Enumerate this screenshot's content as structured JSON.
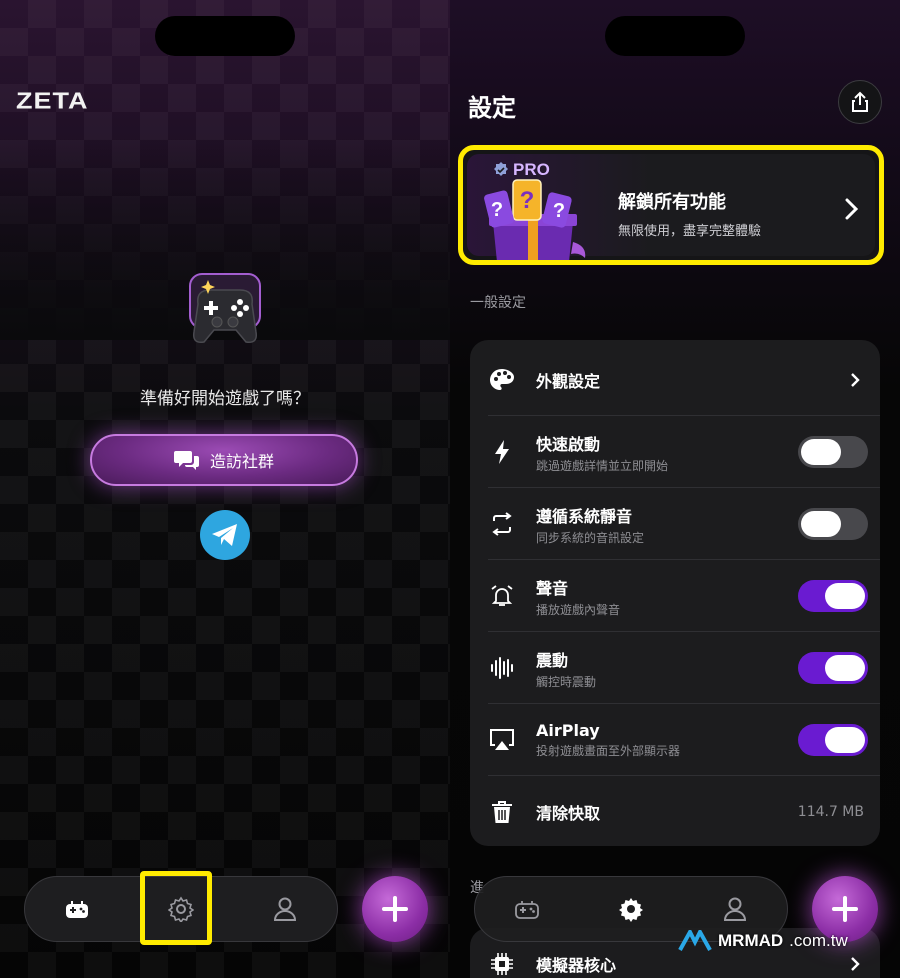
{
  "left": {
    "logo": "ZETA",
    "ready_text": "準備好開始遊戲了嗎？",
    "community_button": "造訪社群",
    "tabbar": {
      "tabs": [
        "games-icon",
        "settings-icon",
        "profile-icon"
      ],
      "selected": "settings-icon"
    }
  },
  "right": {
    "title": "設定",
    "pro": {
      "badge": "PRO",
      "title": "解鎖所有功能",
      "subtitle": "無限使用，盡享完整體驗"
    },
    "general_section": "一般設定",
    "settings": [
      {
        "label": "外觀設定",
        "subtitle": "",
        "control": "chevron",
        "icon": "palette-icon"
      },
      {
        "label": "快速啟動",
        "subtitle": "跳過遊戲詳情並立即開始",
        "control": "toggle",
        "on": false,
        "icon": "bolt-icon"
      },
      {
        "label": "遵循系統靜音",
        "subtitle": "同步系統的音訊設定",
        "control": "toggle",
        "on": false,
        "icon": "sync-icon"
      },
      {
        "label": "聲音",
        "subtitle": "播放遊戲內聲音",
        "control": "toggle",
        "on": true,
        "icon": "alarm-bell-icon"
      },
      {
        "label": "震動",
        "subtitle": "觸控時震動",
        "control": "toggle",
        "on": true,
        "icon": "waveform-icon"
      },
      {
        "label": "AirPlay",
        "subtitle": "投射遊戲畫面至外部顯示器",
        "control": "toggle",
        "on": true,
        "icon": "airplay-icon"
      },
      {
        "label": "清除快取",
        "subtitle": "",
        "control": "value",
        "value": "114.7 MB",
        "icon": "trash-icon"
      }
    ],
    "advanced_section_partial": "進",
    "emulator_core": "模擬器核心",
    "watermark": {
      "brand": "MRMAD",
      "suffix": ".com.tw"
    }
  },
  "colors": {
    "accent_purple": "#6a1bd1",
    "highlight_yellow": "#ffeb00",
    "telegram_blue": "#2ea6e0"
  }
}
